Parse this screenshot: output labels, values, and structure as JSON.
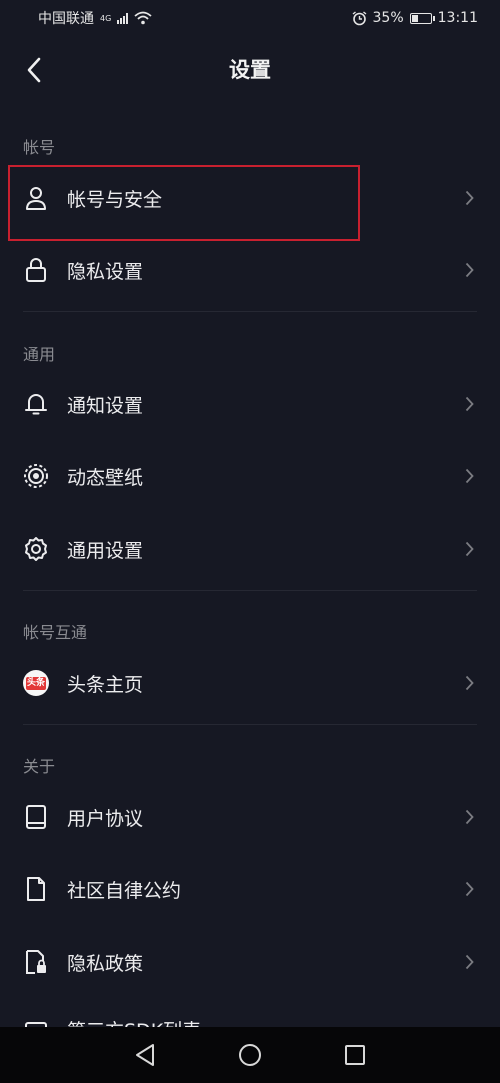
{
  "status_bar": {
    "carrier": "中国联通",
    "network": "4G",
    "battery": "35%",
    "battery_level": 0.35,
    "time": "13:11"
  },
  "header": {
    "title": "设置"
  },
  "sections": {
    "account": {
      "label": "帐号",
      "items": [
        {
          "label": "帐号与安全",
          "icon": "user-icon"
        },
        {
          "label": "隐私设置",
          "icon": "lock-icon"
        }
      ]
    },
    "general": {
      "label": "通用",
      "items": [
        {
          "label": "通知设置",
          "icon": "bell-icon"
        },
        {
          "label": "动态壁纸",
          "icon": "live-wallpaper-icon"
        },
        {
          "label": "通用设置",
          "icon": "gear-icon"
        }
      ]
    },
    "linked": {
      "label": "帐号互通",
      "items": [
        {
          "label": "头条主页",
          "icon": "toutiao-icon",
          "badge_text": "头条"
        }
      ]
    },
    "about": {
      "label": "关于",
      "items": [
        {
          "label": "用户协议",
          "icon": "book-icon"
        },
        {
          "label": "社区自律公约",
          "icon": "document-icon"
        },
        {
          "label": "隐私政策",
          "icon": "privacy-document-icon"
        },
        {
          "label": "第三方SDK列表",
          "icon": "list-icon"
        }
      ]
    }
  },
  "colors": {
    "background": "#161823",
    "text": "#ececee",
    "section_label": "#8a8b91",
    "highlight": "#c8202f"
  }
}
